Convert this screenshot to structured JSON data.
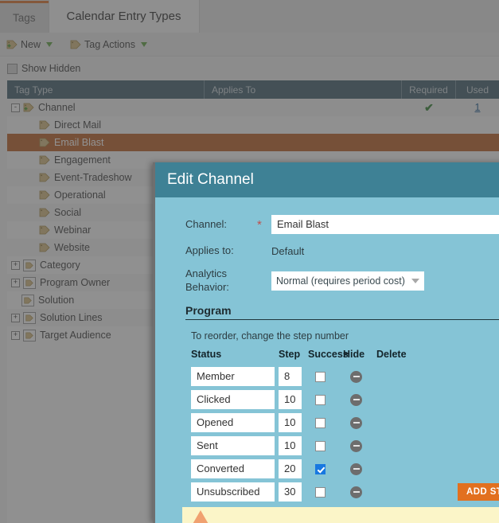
{
  "tabs": [
    {
      "label": "Tags",
      "state": "active"
    },
    {
      "label": "Calendar Entry Types",
      "state": "current"
    }
  ],
  "toolbar": {
    "new_label": "New",
    "tag_actions_label": "Tag Actions",
    "new_icon": "tag-plus-icon",
    "tag_actions_icon": "tag-icon",
    "caret_icon": "chevron-down-icon"
  },
  "filters": {
    "show_hidden_label": "Show Hidden",
    "show_hidden_checked": false
  },
  "grid": {
    "columns": [
      "Tag Type",
      "Applies To",
      "Required",
      "Used"
    ],
    "rows": [
      {
        "label": "Channel",
        "indent": 0,
        "expander": "-",
        "icon": "tag-plus-icon",
        "boxed": false,
        "selected": false,
        "applies_to": "",
        "required": true,
        "used": "1"
      },
      {
        "label": "Direct Mail",
        "indent": 1,
        "expander": "",
        "icon": "tag-icon",
        "boxed": false,
        "selected": false,
        "applies_to": "",
        "required": false,
        "used": ""
      },
      {
        "label": "Email Blast",
        "indent": 1,
        "expander": "",
        "icon": "tag-icon",
        "boxed": false,
        "selected": true,
        "applies_to": "",
        "required": false,
        "used": ""
      },
      {
        "label": "Engagement",
        "indent": 1,
        "expander": "",
        "icon": "tag-icon",
        "boxed": false,
        "selected": false,
        "applies_to": "",
        "required": false,
        "used": ""
      },
      {
        "label": "Event-Tradeshow",
        "indent": 1,
        "expander": "",
        "icon": "tag-icon",
        "boxed": false,
        "selected": false,
        "applies_to": "",
        "required": false,
        "used": ""
      },
      {
        "label": "Operational",
        "indent": 1,
        "expander": "",
        "icon": "tag-icon",
        "boxed": false,
        "selected": false,
        "applies_to": "",
        "required": false,
        "used": ""
      },
      {
        "label": "Social",
        "indent": 1,
        "expander": "",
        "icon": "tag-icon",
        "boxed": false,
        "selected": false,
        "applies_to": "",
        "required": false,
        "used": ""
      },
      {
        "label": "Webinar",
        "indent": 1,
        "expander": "",
        "icon": "tag-icon",
        "boxed": false,
        "selected": false,
        "applies_to": "",
        "required": false,
        "used": ""
      },
      {
        "label": "Website",
        "indent": 1,
        "expander": "",
        "icon": "tag-icon",
        "boxed": false,
        "selected": false,
        "applies_to": "",
        "required": false,
        "used": ""
      },
      {
        "label": "Category",
        "indent": 0,
        "expander": "+",
        "icon": "tag-icon",
        "boxed": true,
        "selected": false,
        "applies_to": "",
        "required": false,
        "used": ""
      },
      {
        "label": "Program Owner",
        "indent": 0,
        "expander": "+",
        "icon": "tag-icon",
        "boxed": true,
        "selected": false,
        "applies_to": "",
        "required": false,
        "used": ""
      },
      {
        "label": "Solution",
        "indent": 0,
        "expander": "",
        "icon": "tag-icon",
        "boxed": true,
        "selected": false,
        "applies_to": "",
        "required": false,
        "used": ""
      },
      {
        "label": "Solution Lines",
        "indent": 0,
        "expander": "+",
        "icon": "tag-icon",
        "boxed": true,
        "selected": false,
        "applies_to": "",
        "required": false,
        "used": ""
      },
      {
        "label": "Target Audience",
        "indent": 0,
        "expander": "+",
        "icon": "tag-icon",
        "boxed": true,
        "selected": false,
        "applies_to": "",
        "required": false,
        "used": ""
      }
    ]
  },
  "dialog": {
    "title": "Edit Channel",
    "channel_label": "Channel:",
    "channel_value": "Email Blast",
    "channel_required_marker": "*",
    "applies_to_label": "Applies to:",
    "applies_to_value": "Default",
    "analytics_label": "Analytics Behavior:",
    "analytics_value": "Normal (requires period cost)",
    "program_section_label": "Program",
    "reorder_hint": "To reorder, change the step number",
    "step_columns": [
      "Status",
      "Step",
      "Success",
      "Hide",
      "Delete"
    ],
    "steps": [
      {
        "status": "Member",
        "step": "8",
        "success": false,
        "hide_icon": "minus-circle-icon"
      },
      {
        "status": "Clicked",
        "step": "10",
        "success": false,
        "hide_icon": "minus-circle-icon"
      },
      {
        "status": "Opened",
        "step": "10",
        "success": false,
        "hide_icon": "minus-circle-icon"
      },
      {
        "status": "Sent",
        "step": "10",
        "success": false,
        "hide_icon": "minus-circle-icon"
      },
      {
        "status": "Converted",
        "step": "20",
        "success": true,
        "hide_icon": "minus-circle-icon"
      },
      {
        "status": "Unsubscribed",
        "step": "30",
        "success": false,
        "hide_icon": "minus-circle-icon"
      }
    ],
    "add_step_label": "ADD STEP",
    "warning_icon": "warning-triangle-icon"
  },
  "colors": {
    "accent_orange": "#e2701f",
    "selected_row": "#c06a33",
    "dialog_header": "#3e8195",
    "dialog_body": "#85c4d6",
    "grid_header": "#4f6a78",
    "checkbox_on": "#1878e0",
    "warning_bg": "#fbf5c8"
  }
}
